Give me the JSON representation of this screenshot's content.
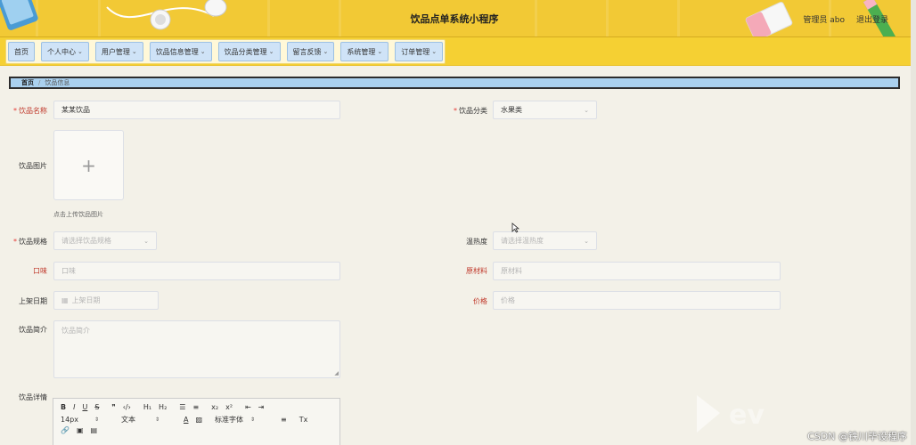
{
  "header": {
    "title": "饮品点单系统小程序",
    "admin_label": "管理员 abo",
    "logout_label": "退出登录"
  },
  "nav": {
    "items": [
      {
        "label": "首页",
        "has_dropdown": false
      },
      {
        "label": "个人中心",
        "has_dropdown": true
      },
      {
        "label": "用户管理",
        "has_dropdown": true
      },
      {
        "label": "饮品信息管理",
        "has_dropdown": true
      },
      {
        "label": "饮品分类管理",
        "has_dropdown": true
      },
      {
        "label": "留言反馈",
        "has_dropdown": true
      },
      {
        "label": "系统管理",
        "has_dropdown": true
      },
      {
        "label": "订单管理",
        "has_dropdown": true
      }
    ]
  },
  "breadcrumb": {
    "home": "首页",
    "separator": "/",
    "current": "饮品信息"
  },
  "form": {
    "name_label": "饮品名称",
    "name_value": "某某饮品",
    "category_label": "饮品分类",
    "category_value": "水果类",
    "image_label": "饮品图片",
    "upload_plus": "+",
    "upload_hint": "点击上传饮品图片",
    "spec_label": "饮品规格",
    "spec_placeholder": "请选择饮品规格",
    "temp_label": "温热度",
    "temp_placeholder": "请选择温热度",
    "taste_label": "口味",
    "taste_placeholder": "口味",
    "material_label": "原材料",
    "material_placeholder": "原材料",
    "date_label": "上架日期",
    "date_placeholder": "上架日期",
    "price_label": "价格",
    "price_placeholder": "价格",
    "intro_label": "饮品简介",
    "intro_placeholder": "饮品简介",
    "detail_label": "饮品详情"
  },
  "editor": {
    "row1": [
      "B",
      "I",
      "U",
      "S",
      "❞",
      "‹/›",
      "H₁",
      "H₂",
      "☰",
      "≡",
      "x₂",
      "x²",
      "⇤",
      "⇥"
    ],
    "font_size": "14px",
    "block_type": "文本",
    "font_family": "标准字体",
    "align_icon": "≡",
    "clear_icon": "Tx",
    "row3": [
      "🔗",
      "▣",
      "▤"
    ]
  },
  "watermark": {
    "csdn": "CSDN @铁川毕设程序"
  },
  "colors": {
    "header_bg": "#f2c935",
    "nav_item_bg": "#cfe3f7",
    "breadcrumb_bg": "#aad1ef",
    "page_bg": "#f3f1e8",
    "required": "#e53935",
    "label_red": "#c0392b"
  }
}
